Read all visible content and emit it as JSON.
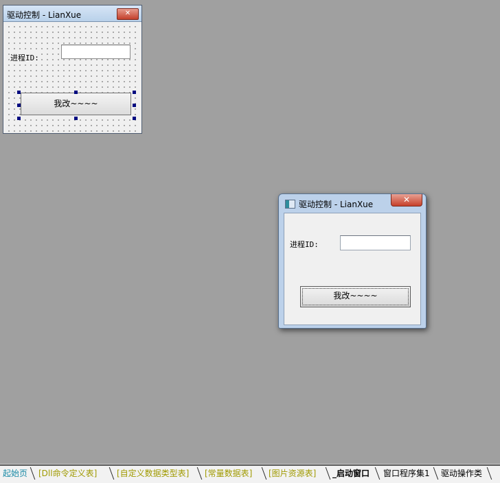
{
  "designer": {
    "title": "驱动控制 - LianXue",
    "close_glyph": "✕",
    "pid_label": "进程ID:",
    "pid_value": "",
    "button_label": "我改~~~~"
  },
  "preview": {
    "title": "驱动控制 - LianXue",
    "close_glyph": "✕",
    "pid_label": "进程ID:",
    "pid_value": "",
    "button_label": "我改~~~~"
  },
  "tabs": [
    {
      "label": "起始页",
      "color": "#1a8aa6"
    },
    {
      "label": "[Dll命令定义表]",
      "color": "#a09a00"
    },
    {
      "label": "[自定义数据类型表]",
      "color": "#a09a00"
    },
    {
      "label": "[常量数据表]",
      "color": "#a09a00"
    },
    {
      "label": "[图片资源表]",
      "color": "#a09a00"
    },
    {
      "label": "_启动窗口",
      "color": "#000000",
      "active": true
    },
    {
      "label": "窗口程序集1",
      "color": "#000000"
    },
    {
      "label": "驱动操作类",
      "color": "#000000"
    }
  ]
}
